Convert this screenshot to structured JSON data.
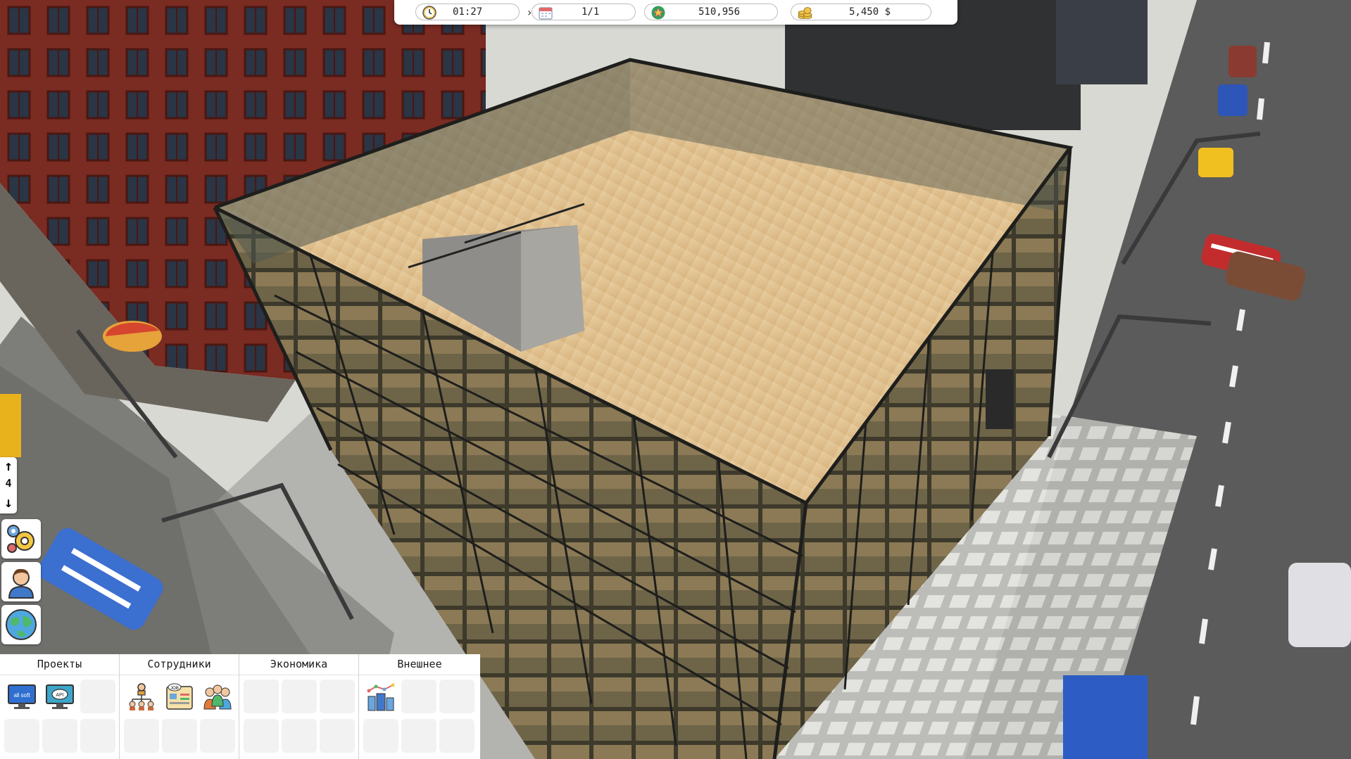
{
  "hud": {
    "time": "01:27",
    "date": "1/1",
    "reputation": "510,956",
    "money": "5,450 $",
    "icons": [
      "clock-icon",
      "calendar-icon",
      "reputation-star-icon",
      "coins-icon"
    ]
  },
  "floor": {
    "current": "4"
  },
  "side_buttons": [
    "settings-gears-icon",
    "employee-avatar-icon",
    "globe-icon"
  ],
  "tabs": [
    {
      "label": "Проекты",
      "items": [
        "all-soft-project-icon",
        "api-project-icon"
      ]
    },
    {
      "label": "Сотрудники",
      "items": [
        "org-chart-icon",
        "job-board-icon",
        "team-icon"
      ]
    },
    {
      "label": "Экономика",
      "items": []
    },
    {
      "label": "Внешнее",
      "items": [
        "city-buildings-icon"
      ]
    }
  ],
  "item_texts": {
    "all_soft": "all soft",
    "api": "API",
    "job": "JOB"
  },
  "colors": {
    "hud_bg": "#ffffff",
    "deck": "#d9b98a",
    "brick": "#7a2b22",
    "road": "#5f5f5f"
  }
}
